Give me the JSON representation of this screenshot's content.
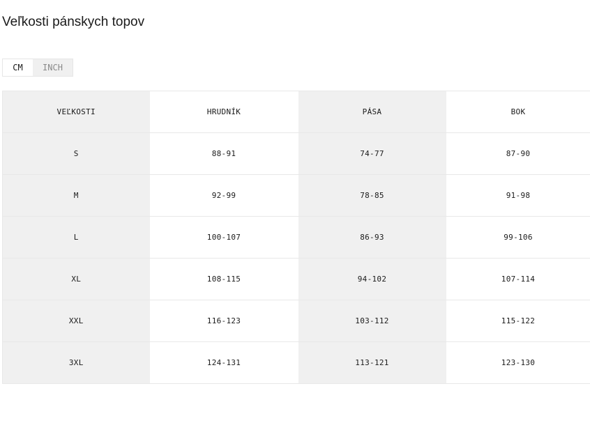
{
  "page": {
    "title": "Veľkosti pánskych topov"
  },
  "units": {
    "cm_label": "CM",
    "inch_label": "INCH",
    "selected": "CM"
  },
  "table": {
    "headers": [
      "VEĽKOSTI",
      "HRUDNÍK",
      "PÁSA",
      "BOK"
    ],
    "rows": [
      [
        "S",
        "88-91",
        "74-77",
        "87-90"
      ],
      [
        "M",
        "92-99",
        "78-85",
        "91-98"
      ],
      [
        "L",
        "100-107",
        "86-93",
        "99-106"
      ],
      [
        "XL",
        "108-115",
        "94-102",
        "107-114"
      ],
      [
        "XXL",
        "116-123",
        "103-112",
        "115-122"
      ],
      [
        "3XL",
        "124-131",
        "113-121",
        "123-130"
      ]
    ]
  },
  "colors": {
    "shaded_column": "#f0f0f0",
    "border": "#e8e8e8",
    "text": "#1a1a1a",
    "inactive_text": "#8a8a8a"
  }
}
